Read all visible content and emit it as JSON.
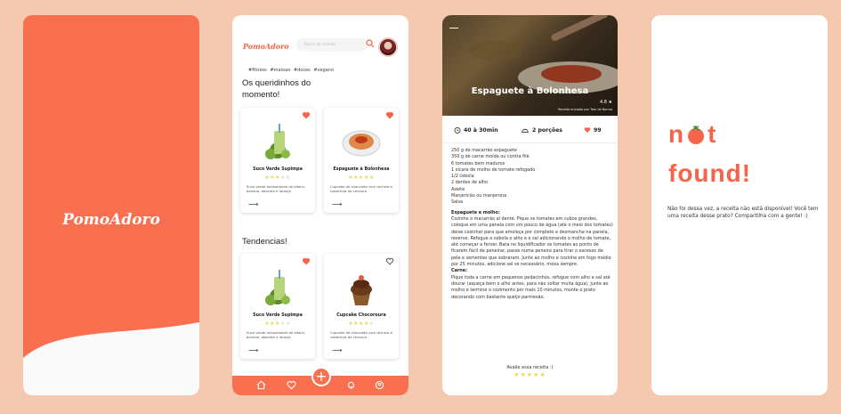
{
  "splash": {
    "logo": "PomoAdoro"
  },
  "home": {
    "brand": "PomoAdoro",
    "search_placeholder": "Busca de receitas",
    "tags": "#fitness #massas #doces #vegano",
    "section1_title": "Os queridinhos do momento!",
    "section2_title": "Tendencias!",
    "cards": [
      {
        "title": "Suco Verde Supimpa",
        "rating": 3,
        "desc": "Suco verde antioxidante de alface, banana, abacate e laranja",
        "fav": true,
        "img": "juice"
      },
      {
        "title": "Espaguete à Bolonhesa",
        "rating": 5,
        "desc": "Cupcake de chocolate com recheio e cobertura de cenoura",
        "fav": true,
        "img": "pasta"
      },
      {
        "title": "Suco Verde Supimpa",
        "rating": 3,
        "desc": "Suco verde antioxidante de alface, banana, abacate e laranja",
        "fav": true,
        "img": "juice"
      },
      {
        "title": "Cupcake Chocoroura",
        "rating": 4,
        "desc": "Cupcake de chocolate com recheio e cobertura de cenoura",
        "fav": false,
        "img": "cupcake"
      }
    ],
    "nav": [
      "home-icon",
      "heart-icon",
      "plus-icon",
      "bell-icon",
      "user-icon"
    ]
  },
  "recipe": {
    "title": "Espaguete à Bolonhesa",
    "rating": "4.8 ★",
    "credit": "Receita enviada por Tom de Bonna",
    "time": "40 à 30min",
    "portions": "2 porções",
    "likes": "99",
    "ingredients": [
      "250 g de macarrão espaguete",
      "350 g de carne moída ou contra filé",
      "6 tomates bem maduros",
      "1 xícara de molho de tomate refogado",
      "1/2 cebola",
      "2 dentes de alho",
      "Azeite",
      "Manjericão ou manjerona",
      "Salsa"
    ],
    "sauce_heading": "Espaguete e molho:",
    "sauce_text": "Cozinhe o macarrão al dente. Pique os tomates em cubos grandes, coloque em uma panela com um pouco de água (até o meio dos tomates) deixe cozinhar para que amoleça por completo e desmanche na panela, reserve. Refogue a cebola o alho e o sal adicionando o molho de tomate, até começar a ferver. Bata no liquidificador os tomates ao ponto de ficarem fácil de peneirar, passe numa peneira para tirar o excesso de pele e sementes que sobraram. Junte ao molho e cozinhe em fogo médio por 25 minutos, adicione sal se necessário, mexa sempre.",
    "meat_heading": "Carne:",
    "meat_text": "Pique toda a carne em pequenos pedacinhos, refogue com alho e sal até dourar (aqueça bem o alho antes, para não soltar muita água). Junte ao molho e termine o cozimento por mais 10 minutos, monte o prato decorando com bastante queijo parmesão.",
    "liked_prompt": "Avalie essa receita :)",
    "liked_stars": "★★★★★"
  },
  "notfound": {
    "line1": "n t",
    "line2": "found!",
    "message": "Não foi dessa vez, a receita não está disponível! Você tem uma receita desse prato? Compartilha com a gente! :)"
  },
  "colors": {
    "accent": "#F87050",
    "background": "#F5C8B0",
    "star": "#E8D94E"
  }
}
